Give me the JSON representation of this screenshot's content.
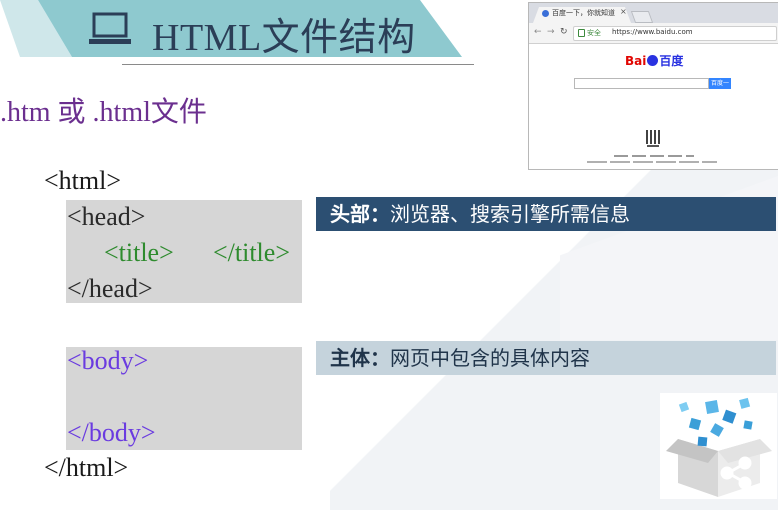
{
  "slide": {
    "title": "HTML文件结构",
    "subtitle": ".htm 或 .html文件",
    "title_icon": "laptop-icon"
  },
  "code": {
    "html_open": "<html>",
    "head_open": "<head>",
    "title_open": "<title>",
    "title_close": "</title>",
    "head_close": "</head>",
    "body_open": "<body>",
    "body_close": "</body>",
    "html_close": "</html>"
  },
  "notes": {
    "head_label": "头部：",
    "head_text": "浏览器、搜索引擎所需信息",
    "body_label": "主体：",
    "body_text": "网页中包含的具体内容"
  },
  "browser": {
    "tab_title": "百度一下，你就知道",
    "secure_label": "安全",
    "url": "https://www.baidu.com",
    "logo_left": "Bai",
    "logo_right": "百度",
    "search_button": "百度一下"
  },
  "colors": {
    "banner": "#8ec9cf",
    "title": "#2b3e57",
    "subtitle": "#6b2f8f",
    "tag_green": "#2e8b2e",
    "tag_purple": "#6a3be0",
    "note_head_bg": "#2c4f72",
    "note_body_bg": "#c5d3dc"
  }
}
